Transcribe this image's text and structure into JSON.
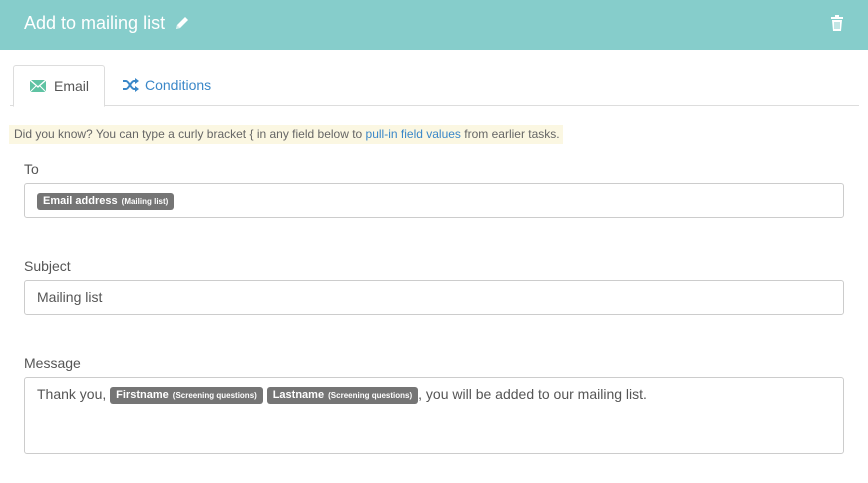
{
  "header": {
    "title": "Add to mailing list",
    "edit_icon": "pencil-icon",
    "delete_icon": "trash-icon",
    "background": "#86cdcb"
  },
  "tabs": [
    {
      "label": "Email",
      "icon": "envelope-icon",
      "active": true
    },
    {
      "label": "Conditions",
      "icon": "shuffle-icon",
      "active": false
    }
  ],
  "hint": {
    "prefix": "Did you know? You can type a curly bracket { in any field below to ",
    "link": "pull-in field values",
    "suffix": " from earlier tasks."
  },
  "to": {
    "label": "To",
    "chip": {
      "field": "Email address",
      "source": "(Mailing list)"
    }
  },
  "subject": {
    "label": "Subject",
    "value": "Mailing list"
  },
  "message": {
    "label": "Message",
    "text_before": "Thank you, ",
    "chip1": {
      "field": "Firstname",
      "source": "(Screening questions)"
    },
    "chip2": {
      "field": "Lastname",
      "source": "(Screening questions)"
    },
    "text_after": ", you will be added to our mailing list."
  }
}
